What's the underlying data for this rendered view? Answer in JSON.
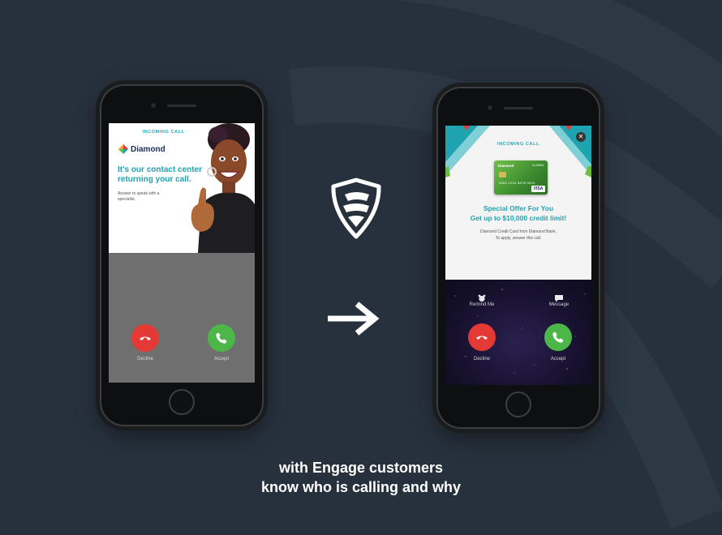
{
  "left_phone": {
    "ad": {
      "header": "INCOMING CALL",
      "brand": "Diamond",
      "headline": "It's our contact center returning your call.",
      "subtext": "Answer to speak with a specialist."
    },
    "decline_label": "Decline",
    "accept_label": "Accept"
  },
  "right_phone": {
    "ad": {
      "header": "INCOMING CALL",
      "card_brand": "Diamond",
      "card_class": "CLASSIC",
      "card_number": "4000 1234 5678 9010",
      "card_network": "VISA",
      "offer_line1": "Special Offer For You",
      "offer_line2": "Get up to $10,000 credit limit!",
      "desc_line1": "Diamond Credit Card from Diamond Bank.",
      "desc_line2": "To apply, answer this call."
    },
    "remind_label": "Remind Me",
    "message_label": "Message",
    "decline_label": "Decline",
    "accept_label": "Accept"
  },
  "tagline": {
    "line1": "with Engage customers",
    "line2": "know who is calling and why"
  },
  "icons": {
    "brand": "engage-shield-logo-icon",
    "arrow": "arrow-right-icon",
    "decline": "phone-hangup-icon",
    "accept": "phone-icon",
    "remind": "alarm-clock-icon",
    "message": "speech-bubble-icon",
    "close": "close-icon"
  },
  "colors": {
    "background": "#27313d",
    "accent_teal": "#1fa3b0",
    "decline_red": "#e53935",
    "accept_green": "#4cb748"
  }
}
